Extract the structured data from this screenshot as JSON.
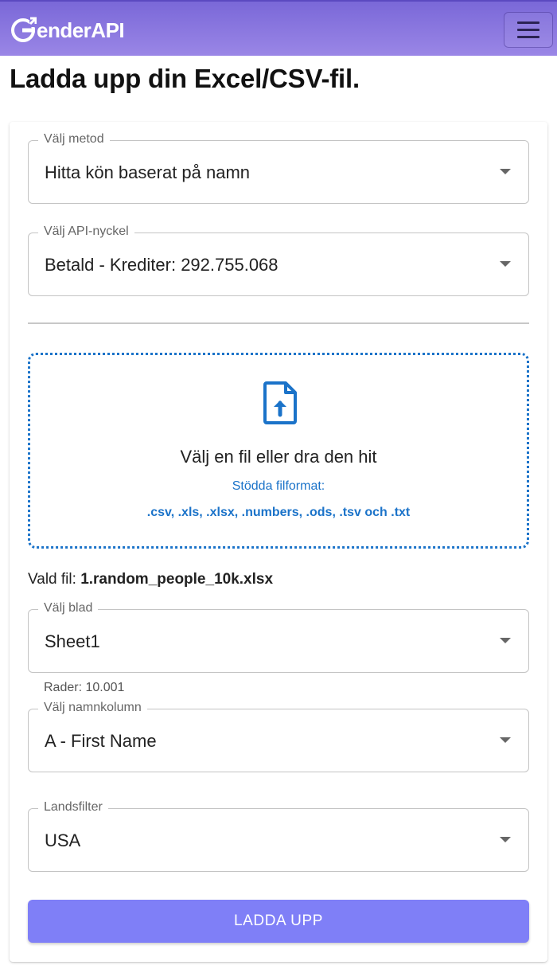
{
  "header": {
    "logo_text": "enderAPI",
    "menu_icon": "hamburger-icon"
  },
  "page": {
    "title": "Ladda upp din Excel/CSV-fil."
  },
  "form": {
    "method": {
      "label": "Välj metod",
      "value": "Hitta kön baserat på namn"
    },
    "api_key": {
      "label": "Välj API-nyckel",
      "value": "Betald - Krediter: 292.755.068"
    },
    "dropzone": {
      "icon": "file-upload-icon",
      "main_text": "Välj en fil eller dra den hit",
      "formats_label": "Stödda filformat:",
      "formats": ".csv, .xls, .xlsx, .numbers, .ods, .tsv och .txt"
    },
    "selected_file": {
      "label": "Vald fil:",
      "name": "1.random_people_10k.xlsx"
    },
    "sheet": {
      "label": "Välj blad",
      "value": "Sheet1",
      "rows_info": "Rader: 10.001"
    },
    "name_column": {
      "label": "Välj namnkolumn",
      "value": "A - First Name"
    },
    "country_filter": {
      "label": "Landsfilter",
      "value": "USA"
    },
    "upload_button": "LADDA UPP"
  },
  "colors": {
    "header": "#8a77e0",
    "accent_blue": "#1b73c9",
    "upload_button": "#7f7ff7"
  }
}
